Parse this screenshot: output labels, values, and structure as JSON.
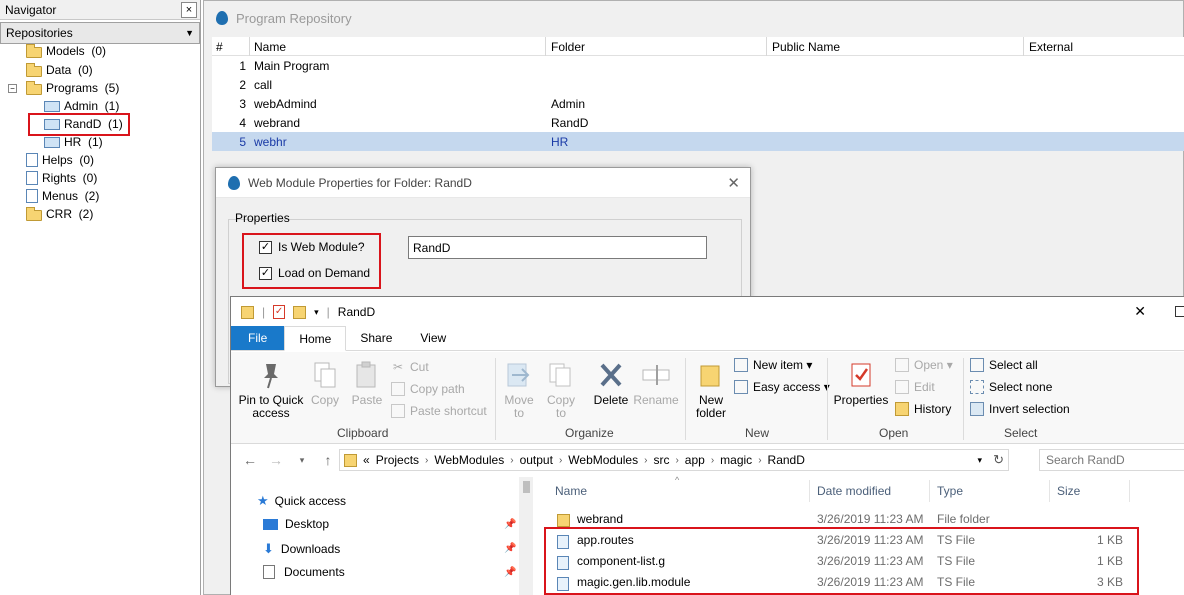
{
  "navigator": {
    "title": "Navigator",
    "close": "×",
    "combo": "Repositories",
    "tree": [
      {
        "label": "Models  (0)"
      },
      {
        "label": "Data  (0)"
      },
      {
        "label": "Programs  (5)"
      },
      {
        "label": "Admin  (1)"
      },
      {
        "label": "RandD  (1)"
      },
      {
        "label": "HR  (1)"
      },
      {
        "label": "Helps  (0)"
      },
      {
        "label": "Rights  (0)"
      },
      {
        "label": "Menus  (2)"
      },
      {
        "label": "CRR  (2)"
      }
    ]
  },
  "repository": {
    "title": "Program Repository",
    "columns": [
      "#",
      "Name",
      "Folder",
      "Public Name",
      "External"
    ],
    "rows": [
      {
        "num": "1",
        "name": "Main Program",
        "folder": ""
      },
      {
        "num": "2",
        "name": "call",
        "folder": ""
      },
      {
        "num": "3",
        "name": "webAdmind",
        "folder": "Admin"
      },
      {
        "num": "4",
        "name": "webrand",
        "folder": "RandD"
      },
      {
        "num": "5",
        "name": "webhr",
        "folder": "HR"
      }
    ]
  },
  "dialog": {
    "title": "Web Module Properties for Folder: RandD",
    "close": "✕",
    "group": "Properties",
    "is_web_module": "Is Web Module?",
    "load_on_demand": "Load on Demand",
    "module_name": "RandD"
  },
  "explorer": {
    "title": "RandD",
    "tabs": [
      "File",
      "Home",
      "Share",
      "View"
    ],
    "ribbon": {
      "pin": "Pin to Quick access",
      "copy": "Copy",
      "paste": "Paste",
      "cut": "Cut",
      "copy_path": "Copy path",
      "paste_shortcut": "Paste shortcut",
      "clipboard": "Clipboard",
      "move_to": "Move to",
      "copy_to": "Copy to",
      "delete": "Delete",
      "rename": "Rename",
      "organize": "Organize",
      "new_folder": "New folder",
      "new_item": "New item ▾",
      "easy_access": "Easy access ▾",
      "new": "New",
      "properties": "Properties",
      "open_item": "Open ▾",
      "edit": "Edit",
      "history": "History",
      "open": "Open",
      "select_all": "Select all",
      "select_none": "Select none",
      "invert_selection": "Invert selection",
      "select": "Select"
    },
    "address": {
      "prefix": "«",
      "crumbs": [
        "Projects",
        "WebModules",
        "output",
        "WebModules",
        "src",
        "app",
        "magic",
        "RandD"
      ]
    },
    "search_placeholder": "Search RandD",
    "sidebar": [
      {
        "label": "Quick access"
      },
      {
        "label": "Desktop"
      },
      {
        "label": "Downloads"
      },
      {
        "label": "Documents"
      }
    ],
    "columns": {
      "name": "Name",
      "date": "Date modified",
      "type": "Type",
      "size": "Size"
    },
    "files": [
      {
        "name": "webrand",
        "date": "3/26/2019 11:23 AM",
        "type": "File folder",
        "size": ""
      },
      {
        "name": "app.routes",
        "date": "3/26/2019 11:23 AM",
        "type": "TS File",
        "size": "1 KB"
      },
      {
        "name": "component-list.g",
        "date": "3/26/2019 11:23 AM",
        "type": "TS File",
        "size": "1 KB"
      },
      {
        "name": "magic.gen.lib.module",
        "date": "3/26/2019 11:23 AM",
        "type": "TS File",
        "size": "3 KB"
      }
    ]
  },
  "colors": {
    "highlight": "#d9141b",
    "selection": "#c5d8ee",
    "accent": "#1979ca"
  }
}
